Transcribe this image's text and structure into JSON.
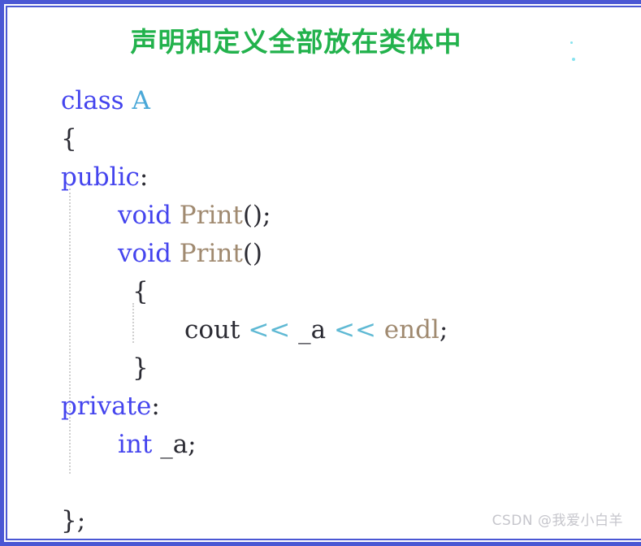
{
  "slide": {
    "title": "声明和定义全部放在类体中",
    "title_color": "#22b24c",
    "border_color": "#4a57d4",
    "background": "#ffffff"
  },
  "colors": {
    "keyword": "#4444ee",
    "type_name": "#4aa8d8",
    "function": "#a08a70",
    "operator": "#5fb9d4",
    "punctuation": "#2b2b33",
    "identifier": "#2b2b33",
    "indent_guide": "#cfcfcf"
  },
  "code": {
    "language": "cpp",
    "lines": [
      {
        "indent": 0,
        "tokens": [
          {
            "t": "class",
            "c": "kw"
          },
          {
            "t": " ",
            "c": "punc"
          },
          {
            "t": "A",
            "c": "type"
          }
        ]
      },
      {
        "indent": 0,
        "tokens": [
          {
            "t": "{",
            "c": "punc"
          }
        ]
      },
      {
        "indent": 0,
        "tokens": [
          {
            "t": "public",
            "c": "kw"
          },
          {
            "t": ":",
            "c": "punc"
          }
        ]
      },
      {
        "indent": 1,
        "tokens": [
          {
            "t": "void",
            "c": "kw"
          },
          {
            "t": " ",
            "c": "punc"
          },
          {
            "t": "Print",
            "c": "fn"
          },
          {
            "t": "();",
            "c": "punc"
          }
        ]
      },
      {
        "indent": 1,
        "tokens": [
          {
            "t": "void",
            "c": "kw"
          },
          {
            "t": " ",
            "c": "punc"
          },
          {
            "t": "Print",
            "c": "fn"
          },
          {
            "t": "()",
            "c": "punc"
          }
        ]
      },
      {
        "indent": 2,
        "tokens": [
          {
            "t": "{",
            "c": "punc"
          }
        ]
      },
      {
        "indent": 3,
        "tokens": [
          {
            "t": "cout",
            "c": "ident"
          },
          {
            "t": " ",
            "c": "punc"
          },
          {
            "t": "<<",
            "c": "op"
          },
          {
            "t": " ",
            "c": "punc"
          },
          {
            "t": "_a",
            "c": "ident"
          },
          {
            "t": " ",
            "c": "punc"
          },
          {
            "t": "<<",
            "c": "op"
          },
          {
            "t": " ",
            "c": "punc"
          },
          {
            "t": "endl",
            "c": "fn"
          },
          {
            "t": ";",
            "c": "punc"
          }
        ]
      },
      {
        "indent": 2,
        "tokens": [
          {
            "t": "}",
            "c": "punc"
          }
        ]
      },
      {
        "indent": 0,
        "tokens": [
          {
            "t": "private",
            "c": "kw"
          },
          {
            "t": ":",
            "c": "punc"
          }
        ]
      },
      {
        "indent": 1,
        "tokens": [
          {
            "t": "int",
            "c": "kw"
          },
          {
            "t": " ",
            "c": "punc"
          },
          {
            "t": "_a;",
            "c": "ident"
          }
        ]
      },
      {
        "indent": 0,
        "tokens": []
      },
      {
        "indent": 0,
        "tokens": [
          {
            "t": "};",
            "c": "punc"
          }
        ]
      }
    ]
  },
  "watermark": {
    "text": "CSDN @我爱小白羊"
  }
}
